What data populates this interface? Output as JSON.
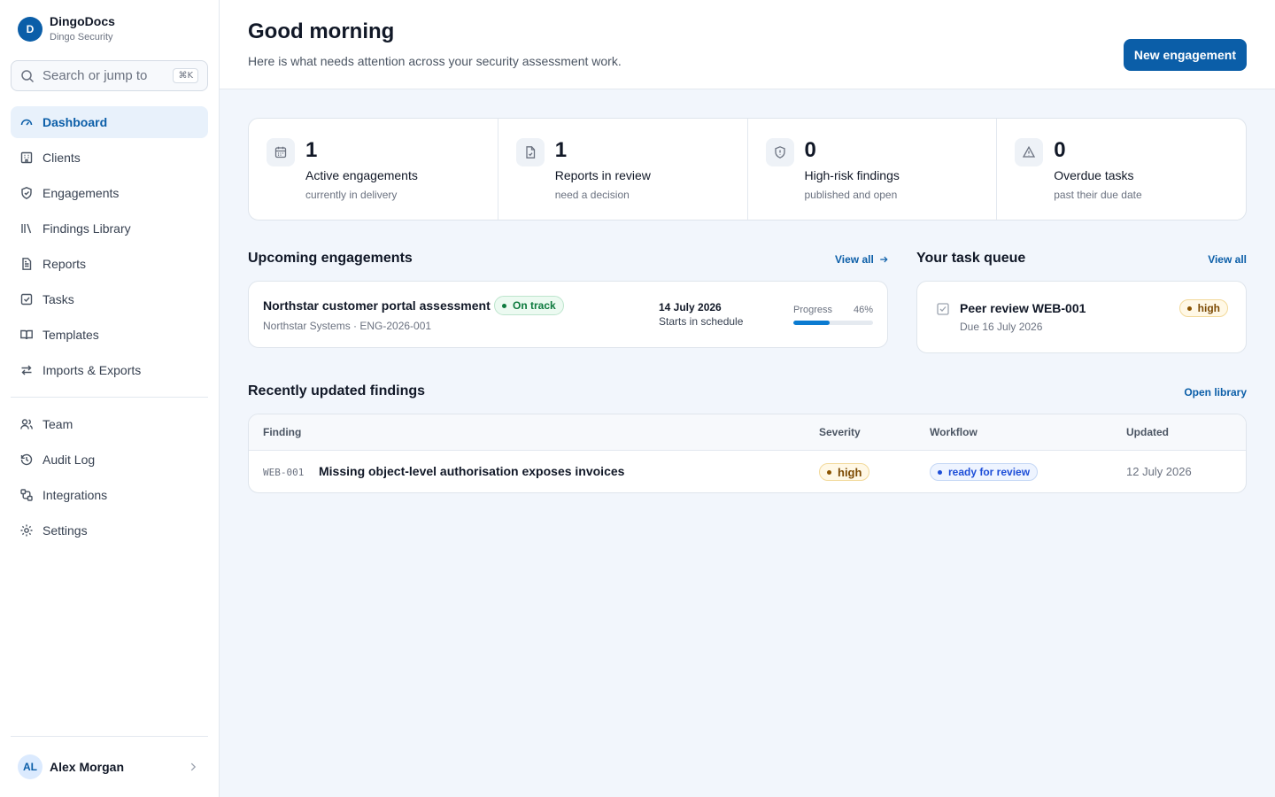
{
  "brand": {
    "initial": "D",
    "name": "DingoDocs",
    "org": "Dingo Security"
  },
  "search": {
    "placeholder": "Search or jump to",
    "shortcut": "⌘K"
  },
  "nav_primary": [
    {
      "label": "Dashboard",
      "icon": "gauge-icon",
      "active": true
    },
    {
      "label": "Clients",
      "icon": "building-icon"
    },
    {
      "label": "Engagements",
      "icon": "shield-icon"
    },
    {
      "label": "Findings Library",
      "icon": "library-icon"
    },
    {
      "label": "Reports",
      "icon": "document-icon"
    },
    {
      "label": "Tasks",
      "icon": "checkbox-icon"
    },
    {
      "label": "Templates",
      "icon": "book-icon"
    },
    {
      "label": "Imports & Exports",
      "icon": "arrows-swap-icon"
    }
  ],
  "nav_secondary": [
    {
      "label": "Team",
      "icon": "users-icon"
    },
    {
      "label": "Audit Log",
      "icon": "history-icon"
    },
    {
      "label": "Integrations",
      "icon": "integration-icon"
    },
    {
      "label": "Settings",
      "icon": "gear-icon"
    }
  ],
  "user": {
    "initials": "AL",
    "name": "Alex Morgan"
  },
  "header": {
    "title": "Good morning",
    "subtitle": "Here is what needs attention across your security assessment work.",
    "primary_action": "New engagement"
  },
  "stats": [
    {
      "value": "1",
      "label": "Active engagements",
      "note": "currently in delivery",
      "icon": "calendar-icon"
    },
    {
      "value": "1",
      "label": "Reports in review",
      "note": "need a decision",
      "icon": "file-icon"
    },
    {
      "value": "0",
      "label": "High-risk findings",
      "note": "published and open",
      "icon": "shield-icon"
    },
    {
      "value": "0",
      "label": "Overdue tasks",
      "note": "past their due date",
      "icon": "warning-icon"
    }
  ],
  "upcoming": {
    "title": "Upcoming engagements",
    "view_all": "View all",
    "item": {
      "name": "Northstar customer portal assessment",
      "meta": "Northstar Systems · ENG-2026-001",
      "status": "On track",
      "date": "14 July 2026",
      "date_note": "Starts in schedule",
      "progress_label": "Progress",
      "progress_text": "46%",
      "progress": 0.46
    }
  },
  "task_queue": {
    "title": "Your task queue",
    "view_all": "View all",
    "item": {
      "title": "Peer review WEB-001",
      "due": "Due 16 July 2026",
      "priority": "high"
    }
  },
  "findings": {
    "title": "Recently updated findings",
    "open_library": "Open library",
    "columns": [
      "Finding",
      "Severity",
      "Workflow",
      "Updated"
    ],
    "rows": [
      {
        "code": "WEB-001",
        "title": "Missing object-level authorisation exposes invoices",
        "severity": "high",
        "workflow": "ready for review",
        "updated": "12 July 2026"
      }
    ]
  },
  "colors": {
    "accent": "#0b5ea8",
    "success": "#0d7a3e",
    "warning": "#7c4a03",
    "info": "#1d4ed8"
  }
}
